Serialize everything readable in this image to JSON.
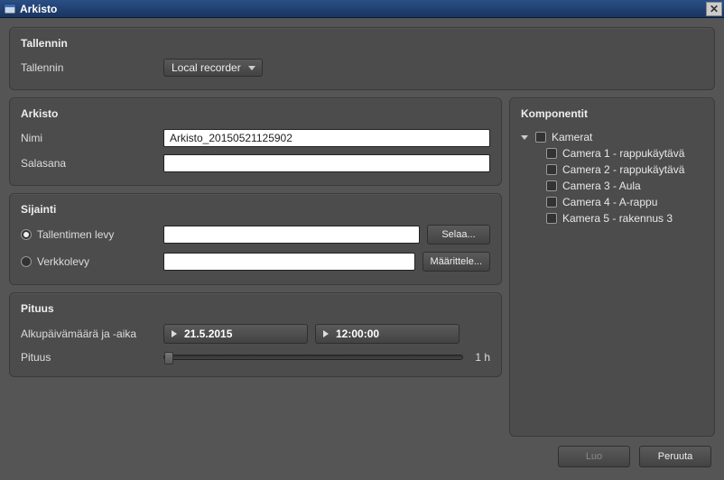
{
  "window": {
    "title": "Arkisto"
  },
  "icons": {
    "close_glyph": "✕"
  },
  "recorder_panel": {
    "title": "Tallennin",
    "label": "Tallennin",
    "selected": "Local recorder"
  },
  "archive_panel": {
    "title": "Arkisto",
    "name_label": "Nimi",
    "name_value": "Arkisto_20150521125902",
    "password_label": "Salasana",
    "password_value": ""
  },
  "location_panel": {
    "title": "Sijainti",
    "option_disk_label": "Tallentimen levy",
    "option_network_label": "Verkkolevy",
    "selected_option": "disk",
    "disk_path": "",
    "network_path": "",
    "browse_label": "Selaa...",
    "define_label": "Määrittele..."
  },
  "length_panel": {
    "title": "Pituus",
    "start_label": "Alkupäivämäärä ja -aika",
    "date_value": "21.5.2015",
    "time_value": "12:00:00",
    "length_label": "Pituus",
    "length_value": "1 h"
  },
  "components_panel": {
    "title": "Komponentit",
    "group_label": "Kamerat",
    "items": [
      "Camera 1 - rappukäytävä",
      "Camera 2 - rappukäytävä",
      "Camera 3 - Aula",
      "Camera 4 - A-rappu",
      "Kamera 5 - rakennus 3"
    ]
  },
  "footer": {
    "create_label": "Luo",
    "cancel_label": "Peruuta"
  }
}
